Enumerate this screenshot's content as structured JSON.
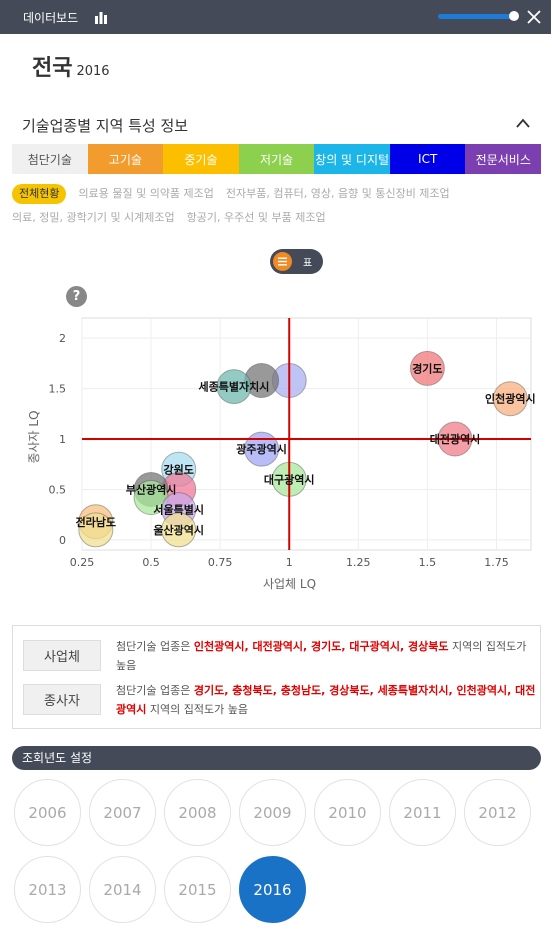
{
  "topbar": {
    "title": "데이터보드"
  },
  "region": {
    "name": "전국",
    "year": "2016"
  },
  "section": {
    "title": "기술업종별 지역 특성 정보"
  },
  "tabs": [
    {
      "label": "첨단기술",
      "color": "#f0f0f0",
      "fg": "#555"
    },
    {
      "label": "고기술",
      "color": "#f39c2e",
      "fg": "#fff"
    },
    {
      "label": "중기술",
      "color": "#fcbf00",
      "fg": "#fff"
    },
    {
      "label": "저기술",
      "color": "#8dd04d",
      "fg": "#fff"
    },
    {
      "label": "창의 및 디지털",
      "color": "#1cb5e8",
      "fg": "#fff"
    },
    {
      "label": "ICT",
      "color": "#0000e8",
      "fg": "#fff"
    },
    {
      "label": "전문서비스",
      "color": "#7b3fb0",
      "fg": "#fff"
    }
  ],
  "subs": [
    {
      "label": "전체현황",
      "active": true
    },
    {
      "label": "의료용 물질 및 의약품 제조업",
      "active": false
    },
    {
      "label": "전자부품, 컴퓨터, 영상, 음향 및 통신장비 제조업",
      "active": false
    },
    {
      "label": "의료, 정밀, 광학기기 및 시계제조업",
      "active": false
    },
    {
      "label": "항공기, 우주선 및 부품 제조업",
      "active": false
    }
  ],
  "toggle": {
    "label": "표"
  },
  "help": {
    "label": "?"
  },
  "chart_data": {
    "type": "scatter",
    "xlabel": "사업체 LQ",
    "ylabel": "종사자 LQ",
    "xlim": [
      0.25,
      1.875
    ],
    "ylim": [
      -0.1,
      2.2
    ],
    "xticks": [
      "0.25",
      "0.5",
      "0.75",
      "1",
      "1.25",
      "1.5",
      "1.75"
    ],
    "xtick_values": [
      0.25,
      0.5,
      0.75,
      1,
      1.25,
      1.5,
      1.75
    ],
    "yticks": [
      "0",
      "0.5",
      "1",
      "1.5",
      "2"
    ],
    "ytick_values": [
      0,
      0.5,
      1,
      1.5,
      2
    ],
    "reference_x": 1,
    "reference_y": 1,
    "points": [
      {
        "label": "",
        "x": 1.0,
        "y": 1.58,
        "color": "#aab0f0"
      },
      {
        "label": "",
        "x": 0.9,
        "y": 1.58,
        "color": "#777777"
      },
      {
        "label": "세종특별자치시",
        "x": 0.8,
        "y": 1.52,
        "color": "#6fb8b0"
      },
      {
        "label": "경기도",
        "x": 1.5,
        "y": 1.7,
        "color": "#f07878"
      },
      {
        "label": "인천광역시",
        "x": 1.8,
        "y": 1.4,
        "color": "#f8b080"
      },
      {
        "label": "대전광역시",
        "x": 1.6,
        "y": 1.0,
        "color": "#f07d8a"
      },
      {
        "label": "광주광역시",
        "x": 0.9,
        "y": 0.9,
        "color": "#a0a6f4"
      },
      {
        "label": "대구광역시",
        "x": 1.0,
        "y": 0.6,
        "color": "#a8e89a"
      },
      {
        "label": "강원도",
        "x": 0.6,
        "y": 0.7,
        "color": "#a8dcf0"
      },
      {
        "label": "",
        "x": 0.6,
        "y": 0.5,
        "color": "#f07a9a"
      },
      {
        "label": "부산광역시",
        "x": 0.5,
        "y": 0.5,
        "color": "#777777"
      },
      {
        "label": "",
        "x": 0.5,
        "y": 0.42,
        "color": "#a8e89a"
      },
      {
        "label": "서울특별시",
        "x": 0.6,
        "y": 0.3,
        "color": "#c8a8e8"
      },
      {
        "label": "전라남도",
        "x": 0.3,
        "y": 0.18,
        "color": "#f8c080"
      },
      {
        "label": "",
        "x": 0.3,
        "y": 0.1,
        "color": "#f0e090"
      },
      {
        "label": "울산광역시",
        "x": 0.6,
        "y": 0.1,
        "color": "#f0e090"
      }
    ]
  },
  "info": {
    "business": {
      "button": "사업체",
      "prefix": "첨단기술 업종은 ",
      "regions": "인천광역시, 대전광역시, 경기도, 대구광역시, 경상북도",
      "suffix": " 지역의 집적도가 높음"
    },
    "workers": {
      "button": "종사자",
      "prefix": "첨단기술 업종은 ",
      "regions": "경기도, 충청북도, 충청남도, 경상북도, 세종특별자치시, 인천광역시, 대전광역시",
      "suffix": " 지역의 집적도가 높음"
    }
  },
  "year_section": {
    "title": "조회년도 설정"
  },
  "years": [
    "2006",
    "2007",
    "2008",
    "2009",
    "2010",
    "2011",
    "2012",
    "2013",
    "2014",
    "2015",
    "2016"
  ],
  "selected_year": "2016"
}
